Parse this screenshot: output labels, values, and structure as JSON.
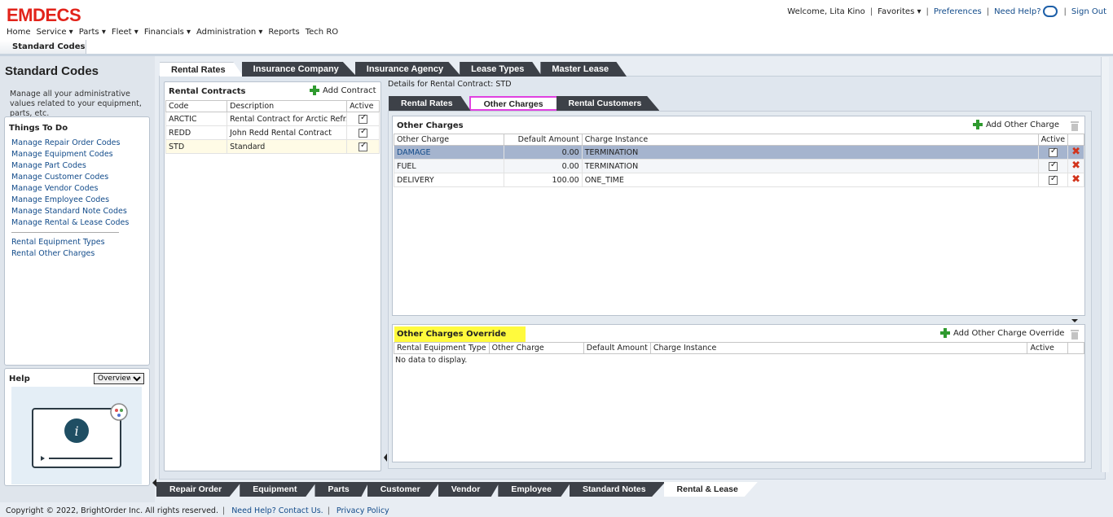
{
  "app": {
    "logo": "EMDECS"
  },
  "menu": [
    "Home",
    "Service ▾",
    "Parts ▾",
    "Fleet ▾",
    "Financials ▾",
    "Administration ▾",
    "Reports",
    "Tech RO"
  ],
  "user": {
    "welcome": "Welcome, Lita Kino",
    "favorites": "Favorites ▾",
    "preferences": "Preferences",
    "need_help": "Need Help?",
    "sign_out": "Sign Out"
  },
  "page_tab": "Standard Codes",
  "sidebar": {
    "title": "Standard Codes",
    "desc": "Manage all your administrative values related to your equipment, parts, etc.",
    "todo_title": "Things To Do",
    "links": [
      "Manage Repair Order Codes",
      "Manage Equipment Codes",
      "Manage Part Codes",
      "Manage Customer Codes",
      "Manage Vendor Codes",
      "Manage Employee Codes",
      "Manage Standard Note Codes",
      "Manage Rental & Lease Codes"
    ],
    "links2": [
      "Rental Equipment Types",
      "Rental Other Charges"
    ],
    "help_title": "Help",
    "help_option": "Overview"
  },
  "top_tabs": [
    "Rental Rates",
    "Insurance Company",
    "Insurance Agency",
    "Lease Types",
    "Master Lease"
  ],
  "contracts": {
    "title": "Rental Contracts",
    "add": "Add Contract",
    "headers": [
      "Code",
      "Description",
      "Active"
    ],
    "rows": [
      {
        "code": "ARCTIC",
        "desc": "Rental Contract for Arctic Refr...",
        "active": true
      },
      {
        "code": "REDD",
        "desc": "John Redd Rental Contract",
        "active": true
      },
      {
        "code": "STD",
        "desc": "Standard",
        "active": true
      }
    ]
  },
  "details_label": "Details for Rental Contract: STD",
  "sub_tabs": [
    "Rental Rates",
    "Other Charges",
    "Rental Customers"
  ],
  "other_charges": {
    "title": "Other Charges",
    "add": "Add Other Charge",
    "headers": [
      "Other Charge",
      "Default Amount",
      "Charge Instance",
      "Active"
    ],
    "rows": [
      {
        "charge": "DAMAGE",
        "amount": "0.00",
        "instance": "TERMINATION",
        "active": true
      },
      {
        "charge": "FUEL",
        "amount": "0.00",
        "instance": "TERMINATION",
        "active": true
      },
      {
        "charge": "DELIVERY",
        "amount": "100.00",
        "instance": "ONE_TIME",
        "active": true
      }
    ]
  },
  "override": {
    "title": "Other Charges Override",
    "add": "Add Other Charge Override",
    "headers": [
      "Rental Equipment Type",
      "Other Charge",
      "Default Amount",
      "Charge Instance",
      "Active"
    ],
    "empty": "No data to display."
  },
  "bottom_tabs": [
    "Repair Order",
    "Equipment",
    "Parts",
    "Customer",
    "Vendor",
    "Employee",
    "Standard Notes",
    "Rental & Lease"
  ],
  "footer": {
    "copyright": "Copyright © 2022, BrightOrder Inc. All rights reserved.",
    "help": "Need Help? Contact Us.",
    "privacy": "Privacy Policy"
  },
  "colors": {
    "brand": "#e2231a",
    "tab_dark": "#3d4148",
    "link": "#124b8a",
    "selected_row": "#a5b4ce",
    "highlight": "#fffa3d"
  }
}
